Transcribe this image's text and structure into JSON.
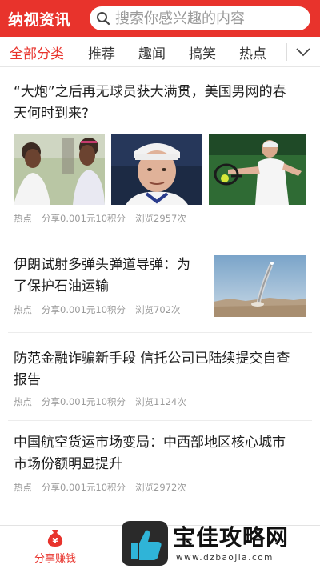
{
  "header": {
    "app_title": "纳视资讯",
    "search_placeholder": "搜索你感兴趣的内容"
  },
  "tabs": [
    {
      "label": "全部分类",
      "active": true
    },
    {
      "label": "推荐",
      "active": false
    },
    {
      "label": "趣闻",
      "active": false
    },
    {
      "label": "搞笑",
      "active": false
    },
    {
      "label": "热点",
      "active": false
    }
  ],
  "articles": [
    {
      "title_line1": "“大炮”之后再无球员获大满贯，美国男网的春",
      "title_line2": "天何时到来?",
      "tag": "热点",
      "share": "分享0.001元10积分",
      "views": "浏览2957次"
    },
    {
      "title_line1": "伊朗试射多弹头弹道导弹：为",
      "title_line2": "了保护石油运输",
      "tag": "热点",
      "share": "分享0.001元10积分",
      "views": "浏览702次"
    },
    {
      "title_line1": "防范金融诈骗新手段 信托公司已陆续提交自查",
      "title_line2": "报告",
      "tag": "热点",
      "share": "分享0.001元10积分",
      "views": "浏览1124次"
    },
    {
      "title_line1": "中国航空货运市场变局：中西部地区核心城市",
      "title_line2": "市场份额明显提升",
      "tag": "热点",
      "share": "分享0.001元10积分",
      "views": "浏览2972次"
    }
  ],
  "bottom_bar": {
    "share_label": "分享赚钱"
  },
  "watermark": {
    "text": "宝佳攻略网",
    "url": "www.dzbaojia.com"
  },
  "colors": {
    "brand_red": "#e8332c",
    "meta_gray": "#9a9a9a"
  }
}
